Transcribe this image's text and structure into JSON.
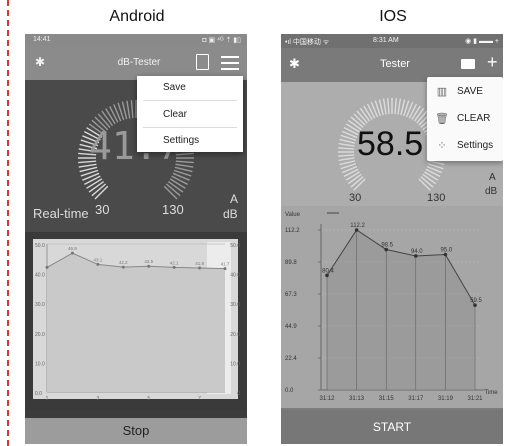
{
  "labels": {
    "android": "Android",
    "ios": "IOS"
  },
  "android": {
    "status": {
      "time": "14:41",
      "icons": "◘ ▣ ⁴ᴳ ⇡ ▮▯"
    },
    "appbar": {
      "title": "dB-Tester"
    },
    "menu": {
      "save": "Save",
      "clear": "Clear",
      "settings": "Settings"
    },
    "meter": {
      "value": "41.7",
      "realtime_label": "Real-time",
      "scale_min": "30",
      "scale_max": "130",
      "unit_a": "A",
      "unit_db": "dB"
    },
    "stop_label": "Stop"
  },
  "ios": {
    "status": {
      "carrier": "•ıl 中国移动 ᯤ",
      "time": "8:31 AM",
      "battery": "◉ ▮ ▬▬ +"
    },
    "navbar": {
      "title": "Tester"
    },
    "menu": {
      "save": "SAVE",
      "clear": "CLEAR",
      "settings": "Settings"
    },
    "meter": {
      "value": "58.5",
      "scale_min": "30",
      "scale_max": "130",
      "unit_a": "A",
      "unit_db": "dB"
    },
    "start_label": "START"
  },
  "chart_data": [
    {
      "type": "line",
      "title": "",
      "ylim": [
        0,
        50
      ],
      "xlim": [
        1,
        8
      ],
      "x_ticks": [
        "1",
        "3",
        "5",
        "7"
      ],
      "y_ticks_left": [
        "0.0",
        "10.0",
        "20.0",
        "30.0",
        "40.0",
        "50.0"
      ],
      "y_ticks_right": [
        "0",
        "10.0",
        "20.0",
        "30.0",
        "40.0",
        "50.0"
      ],
      "x": [
        1,
        2,
        3,
        4,
        5,
        6,
        7,
        8
      ],
      "values": [
        42.1,
        46.9,
        43.1,
        42.2,
        42.5,
        42.1,
        41.9,
        41.7
      ],
      "point_labels": [
        "",
        "46.9",
        "43.1",
        "42.2",
        "42.5",
        "42.1",
        "41.9",
        "41.7"
      ]
    },
    {
      "type": "area",
      "title": "",
      "ylabel": "Value",
      "xlabel": "Time",
      "ylim": [
        0,
        112.2
      ],
      "y_ticks": [
        "0.0",
        "22.4",
        "44.9",
        "67.3",
        "89.8",
        "112.2"
      ],
      "categories": [
        "31:12",
        "31:13",
        "31:15",
        "31:17",
        "31:19",
        "31:21"
      ],
      "values": [
        80.4,
        112.2,
        98.5,
        94.0,
        95.0,
        59.5
      ],
      "point_labels": [
        "80.4",
        "112.2",
        "98.5",
        "94.0",
        "95.0",
        "59.5"
      ]
    }
  ]
}
